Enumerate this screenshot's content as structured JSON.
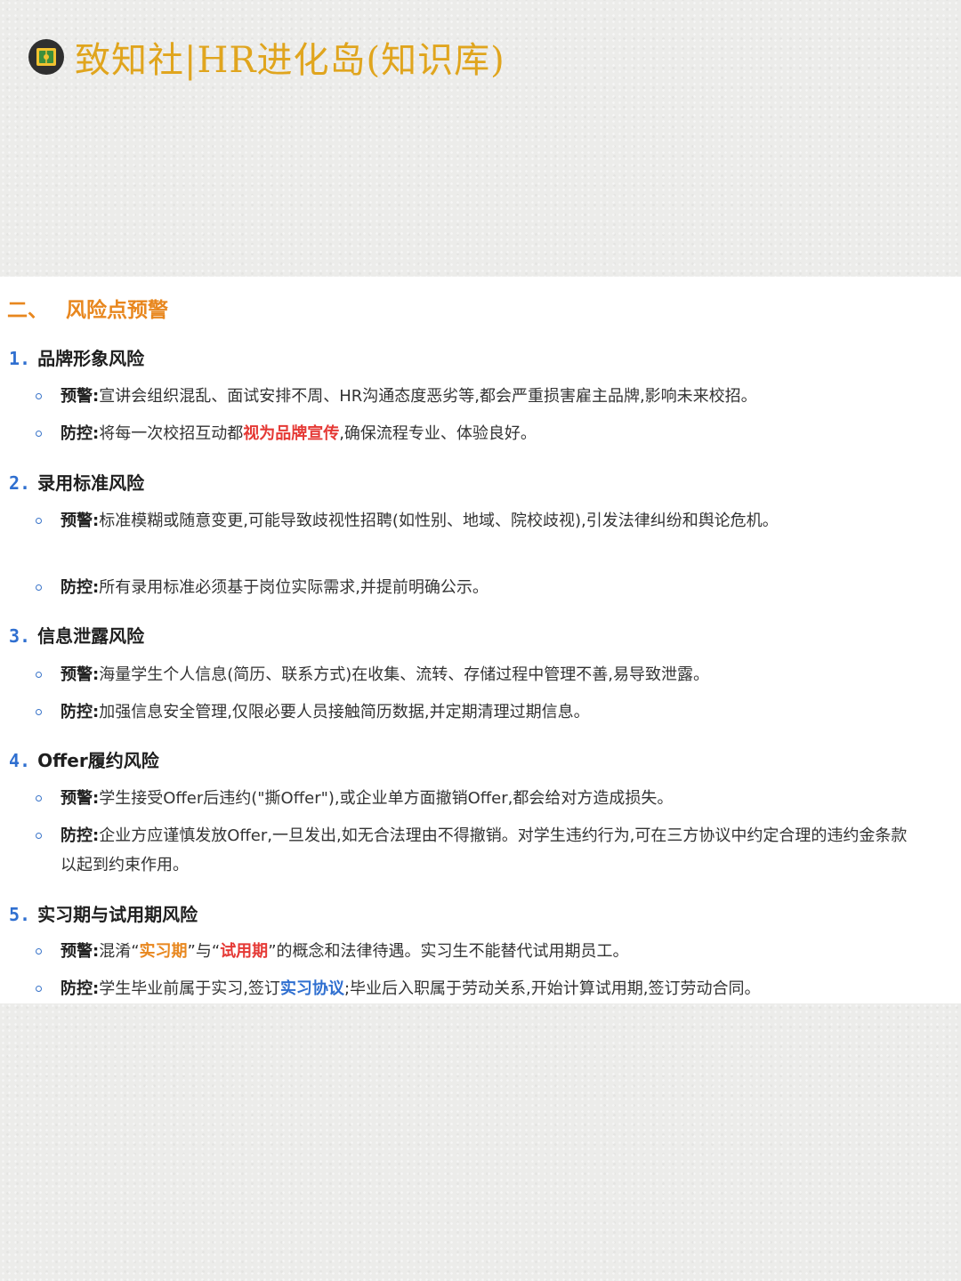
{
  "header": {
    "brand": "致知社|HR进化岛(知识库)",
    "logo_icon": "book-logo-icon"
  },
  "section": {
    "number": "二、",
    "title": "风险点预警"
  },
  "items": [
    {
      "index": "1.",
      "title": "品牌形象风险",
      "warn_label": "预警:",
      "warn_text": "宣讲会组织混乱、面试安排不周、HR沟通态度恶劣等,都会严重损害雇主品牌,影响未来校招。",
      "ctrl_label": "防控:",
      "ctrl_pre": "将每一次校招互动都",
      "ctrl_highlight": "视为品牌宣传",
      "ctrl_post": ",确保流程专业、体验良好。"
    },
    {
      "index": "2.",
      "title": "录用标准风险",
      "warn_label": "预警:",
      "warn_text": "标准模糊或随意变更,可能导致歧视性招聘(如性别、地域、院校歧视),引发法律纠纷和舆论危机。",
      "ctrl_label": "防控:",
      "ctrl_text": "所有录用标准必须基于岗位实际需求,并提前明确公示。"
    },
    {
      "index": "3.",
      "title": "信息泄露风险",
      "warn_label": "预警:",
      "warn_text": "海量学生个人信息(简历、联系方式)在收集、流转、存储过程中管理不善,易导致泄露。",
      "ctrl_label": "防控:",
      "ctrl_text": "加强信息安全管理,仅限必要人员接触简历数据,并定期清理过期信息。"
    },
    {
      "index": "4.",
      "title": "Offer履约风险",
      "warn_label": "预警:",
      "warn_text": "学生接受Offer后违约(\"撕Offer\"),或企业单方面撤销Offer,都会给对方造成损失。",
      "ctrl_label": "防控:",
      "ctrl_text": "企业方应谨慎发放Offer,一旦发出,如无合法理由不得撤销。对学生违约行为,可在三方协议中约定合理的违约金条款以起到约束作用。"
    },
    {
      "index": "5.",
      "title": "实习期与试用期风险",
      "warn_label": "预警:",
      "warn_pre": "混淆“",
      "warn_hl1": "实习期",
      "warn_mid": "”与“",
      "warn_hl2": "试用期",
      "warn_post": "”的概念和法律待遇。实习生不能替代试用期员工。",
      "ctrl_label": "防控:",
      "ctrl_pre": "学生毕业前属于实习,签订",
      "ctrl_highlight": "实习协议",
      "ctrl_post": ";毕业后入职属于劳动关系,开始计算试用期,签订劳动合同。"
    }
  ]
}
